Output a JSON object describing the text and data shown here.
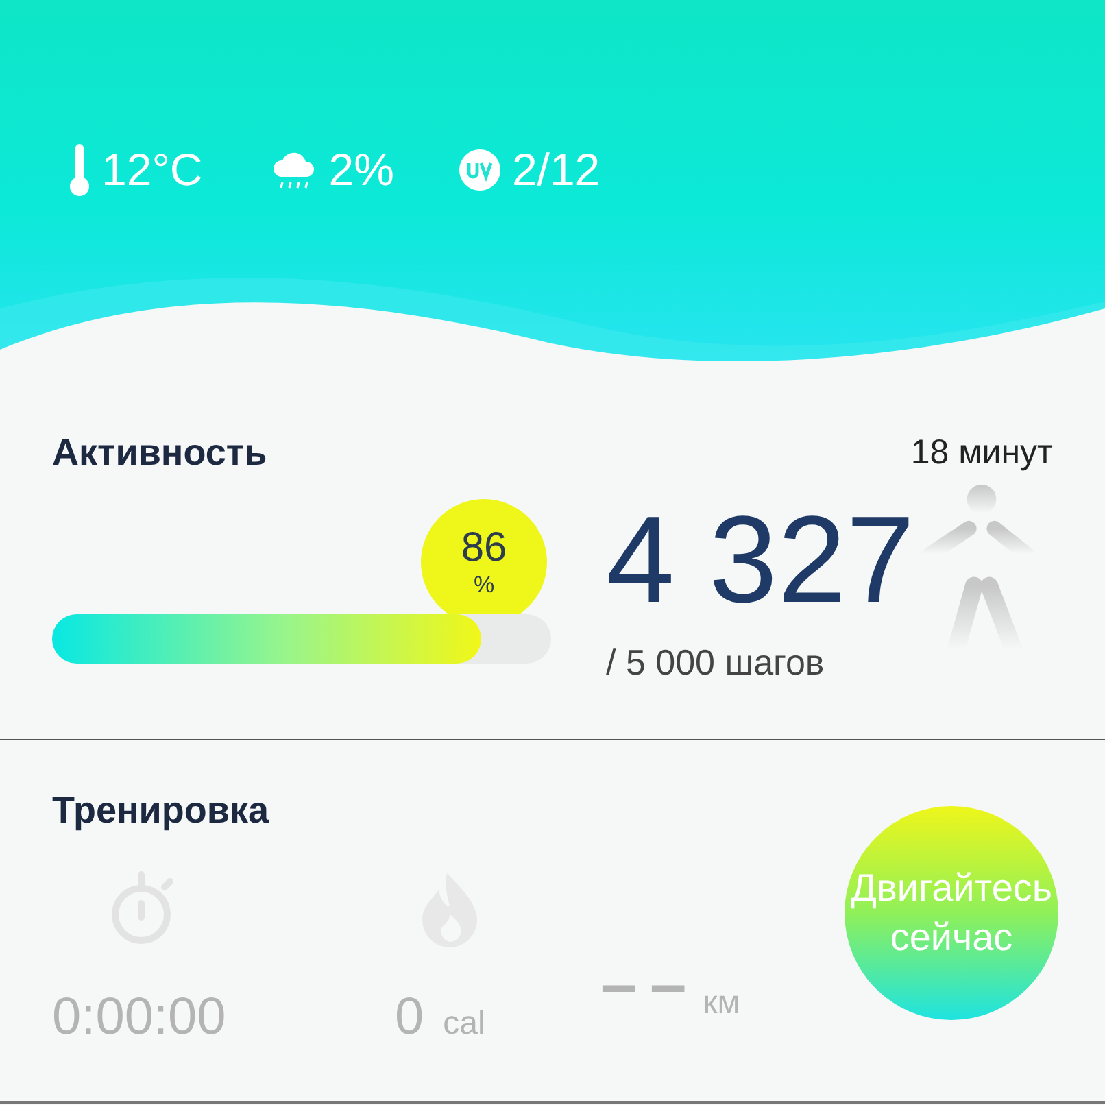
{
  "weather": [
    {
      "kind": "temperature",
      "value": "12°C"
    },
    {
      "kind": "rain",
      "value": "2%"
    },
    {
      "kind": "uv",
      "value": "2/12"
    }
  ],
  "activity": {
    "title": "Активность",
    "duration": "18 минут",
    "level": 0.86,
    "percent": "86",
    "percent_sign": "%",
    "steps": "4 327",
    "goal": "/ 5 000 шагов"
  },
  "workout": {
    "title": "Тренировка",
    "stats": [
      {
        "kind": "time",
        "value": "0:00:00"
      },
      {
        "kind": "calories",
        "value": "0",
        "unit": "cal"
      },
      {
        "kind": "distance",
        "value": "– –",
        "unit": "км"
      }
    ],
    "button": "Двигайтесь сейчас"
  }
}
